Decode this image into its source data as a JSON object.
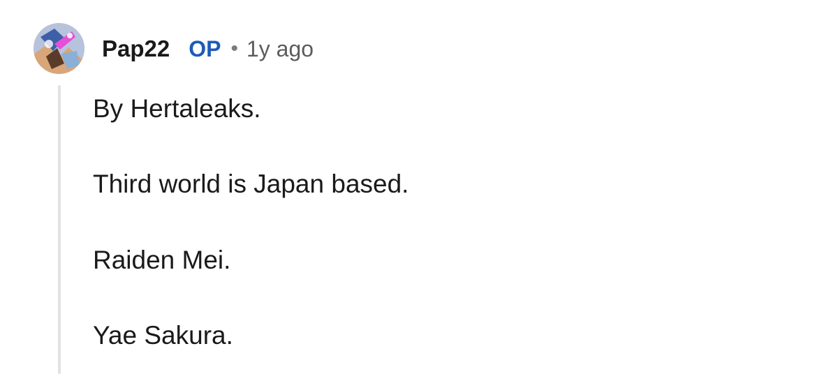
{
  "comment": {
    "author": "Pap22",
    "badge": "OP",
    "separator": "•",
    "timestamp": "1y ago",
    "avatar_icon": "user-avatar-artwork",
    "paragraphs": [
      "By Hertaleaks.",
      "Third world is Japan based.",
      "Raiden Mei.",
      "Yae Sakura."
    ],
    "colors": {
      "badge": "#1e5bb8",
      "text": "#1a1a1b",
      "meta": "#5c5c5e",
      "thread_line": "#e1e2e4"
    }
  }
}
